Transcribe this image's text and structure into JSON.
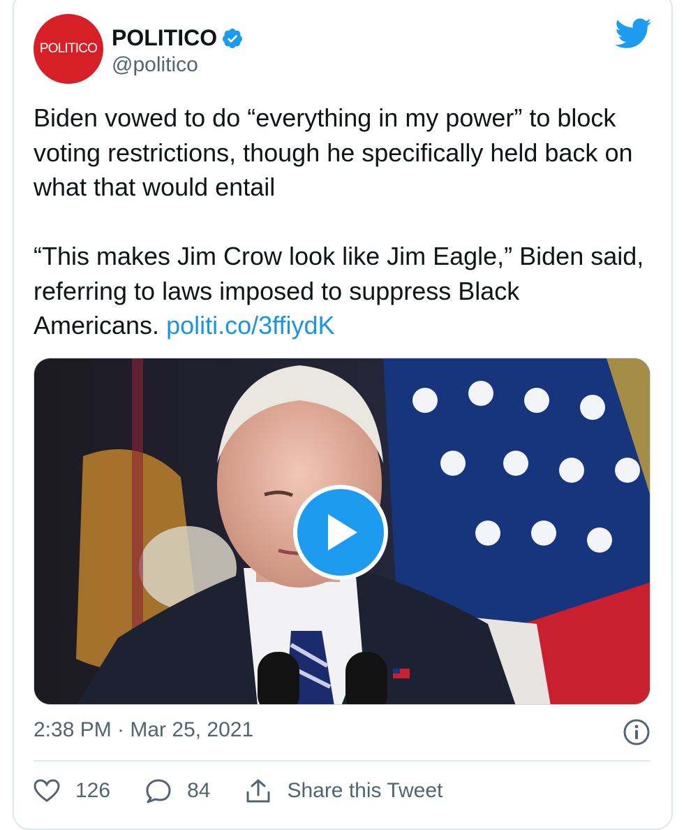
{
  "account": {
    "avatar_text": "POLITICO",
    "display_name": "POLITICO",
    "handle": "@politico",
    "verified": true,
    "avatar_color": "#d61f26"
  },
  "tweet": {
    "paragraph1": "Biden vowed to do “everything in my power” to block voting restrictions, though he specifically held back on what that would entail",
    "paragraph2": "“This makes Jim Crow look like Jim Eagle,” Biden said, referring to laws imposed to suppress Black Americans.",
    "link": "politi.co/3ffiydK",
    "link_color": "#1b95e0"
  },
  "media": {
    "type": "video",
    "play_icon": "play-icon"
  },
  "meta": {
    "timestamp": "2:38 PM · Mar 25, 2021"
  },
  "actions": {
    "likes": "126",
    "replies": "84",
    "share_label": "Share this Tweet"
  },
  "colors": {
    "twitter_blue": "#1d9bf0",
    "muted_text": "#536471"
  }
}
